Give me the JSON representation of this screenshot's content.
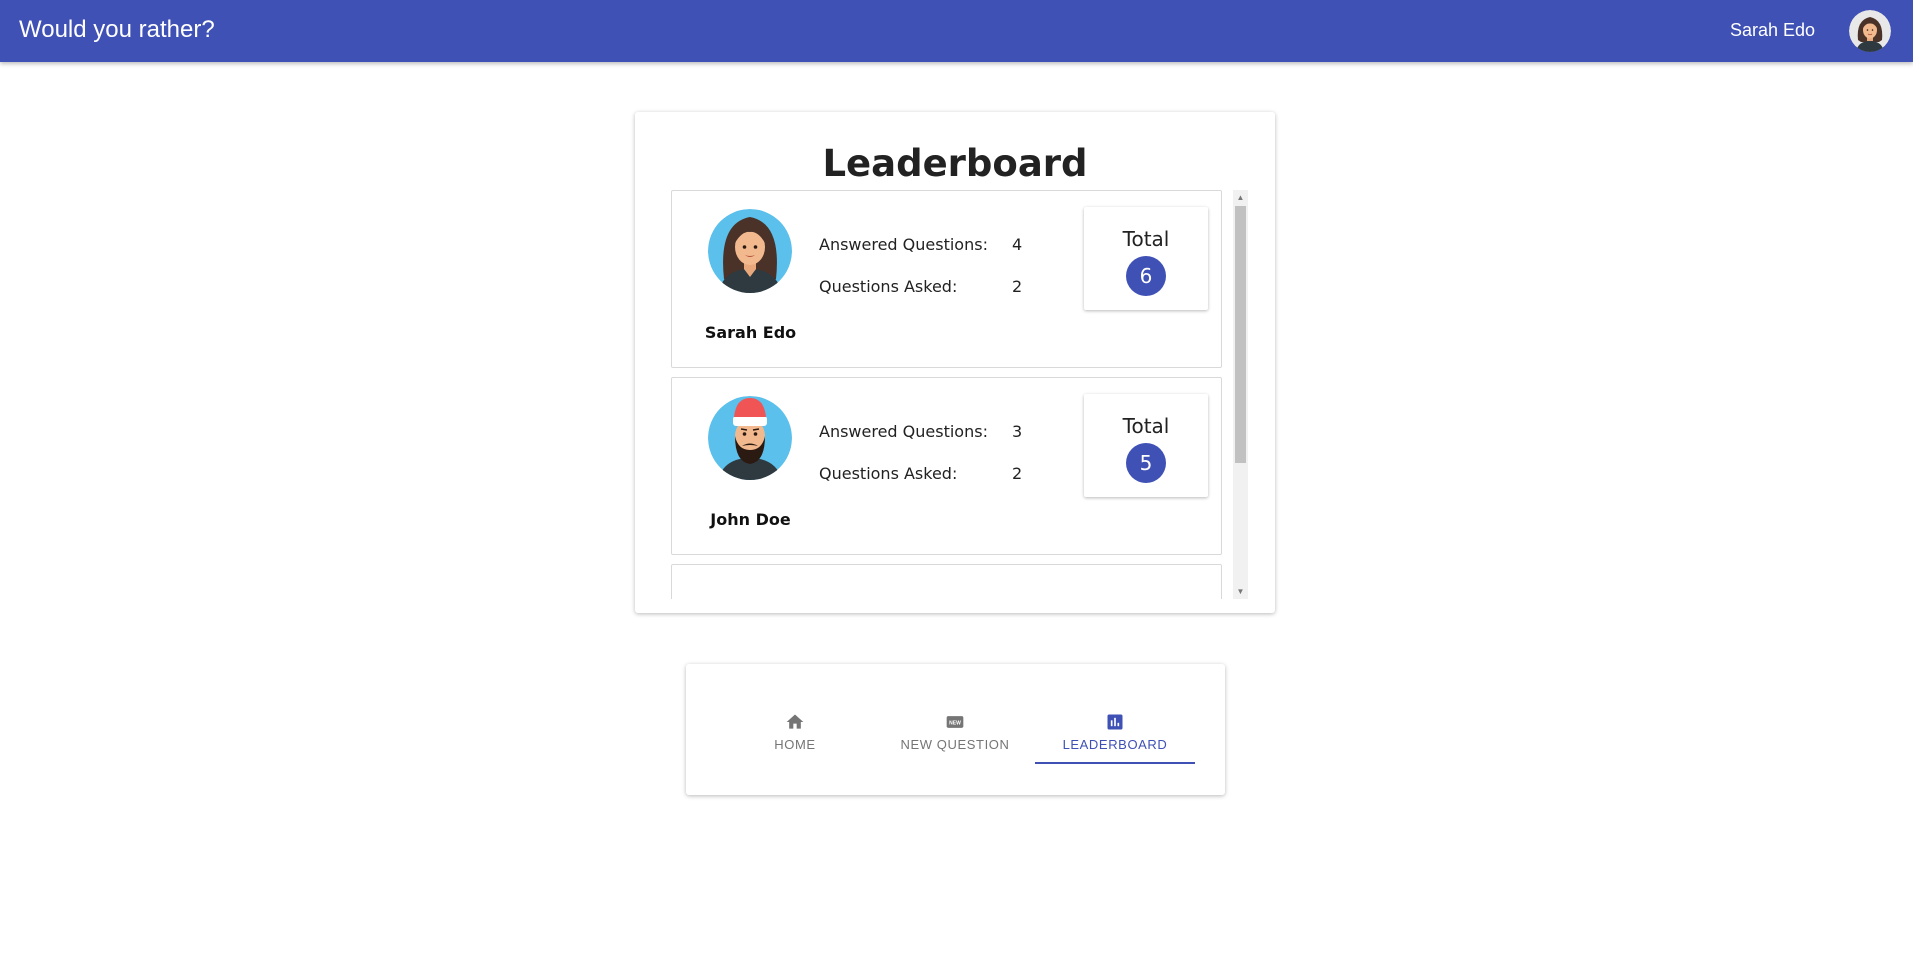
{
  "appbar": {
    "title": "Would you rather?",
    "user_name": "Sarah Edo"
  },
  "leaderboard": {
    "title": "Leaderboard",
    "answered_label": "Answered Questions:",
    "asked_label": "Questions Asked:",
    "total_label": "Total",
    "entries": [
      {
        "name": "Sarah Edo",
        "answered": "4",
        "asked": "2",
        "total": "6",
        "avatar": "woman-avatar-icon"
      },
      {
        "name": "John Doe",
        "answered": "3",
        "asked": "2",
        "total": "5",
        "avatar": "bearded-man-avatar-icon"
      }
    ]
  },
  "nav": {
    "tabs": [
      {
        "label": "HOME",
        "icon": "home-icon"
      },
      {
        "label": "NEW QUESTION",
        "icon": "new-badge-icon"
      },
      {
        "label": "LEADERBOARD",
        "icon": "bar-chart-icon",
        "active": true
      }
    ]
  },
  "colors": {
    "primary": "#3f51b5",
    "avatar_bg": "#5bc0eb",
    "inactive_tab": "#757575"
  }
}
